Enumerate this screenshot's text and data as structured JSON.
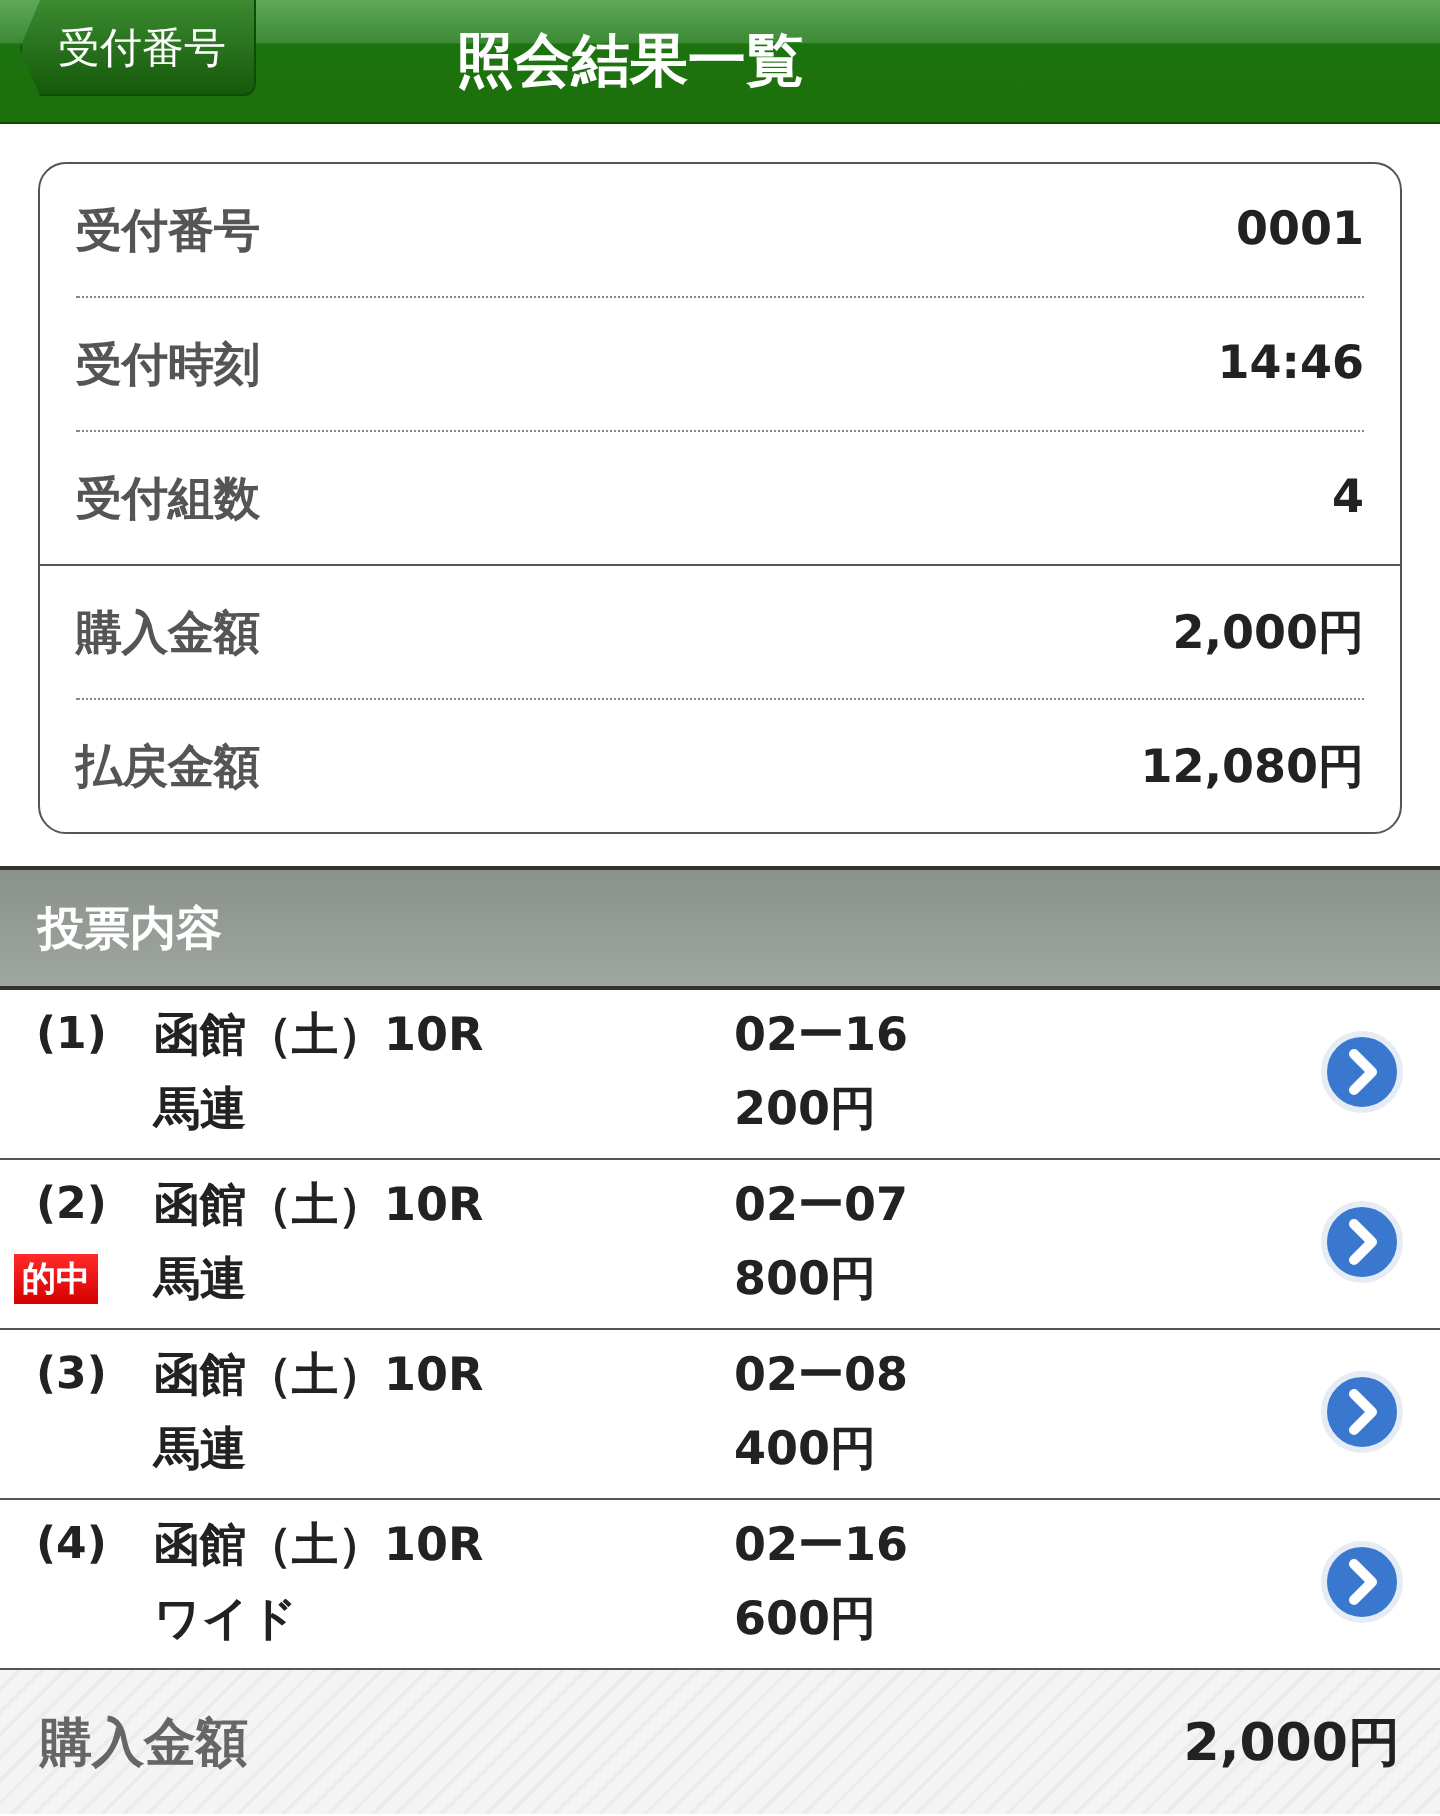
{
  "header": {
    "back_button": "受付番号",
    "title": "照会結果一覧"
  },
  "summary": {
    "groups": [
      [
        {
          "label": "受付番号",
          "value": "0001"
        },
        {
          "label": "受付時刻",
          "value": "14:46"
        },
        {
          "label": "受付組数",
          "value": "4"
        }
      ],
      [
        {
          "label": "購入金額",
          "value": "2,000円"
        },
        {
          "label": "払戻金額",
          "value": "12,080円"
        }
      ]
    ]
  },
  "section": {
    "title": "投票内容"
  },
  "bets": [
    {
      "number": "(1)",
      "race": "函館（土）10R",
      "combination": "02ー16",
      "type": "馬連",
      "amount": "200円"
    },
    {
      "number": "(2)",
      "badge": "的中",
      "race": "函館（土）10R",
      "combination": "02ー07",
      "type": "馬連",
      "amount": "800円"
    },
    {
      "number": "(3)",
      "race": "函館（土）10R",
      "combination": "02ー08",
      "type": "馬連",
      "amount": "400円"
    },
    {
      "number": "(4)",
      "race": "函館（土）10R",
      "combination": "02ー16",
      "type": "ワイド",
      "amount": "600円"
    }
  ],
  "footer": {
    "label": "購入金額",
    "value": "2,000円"
  }
}
